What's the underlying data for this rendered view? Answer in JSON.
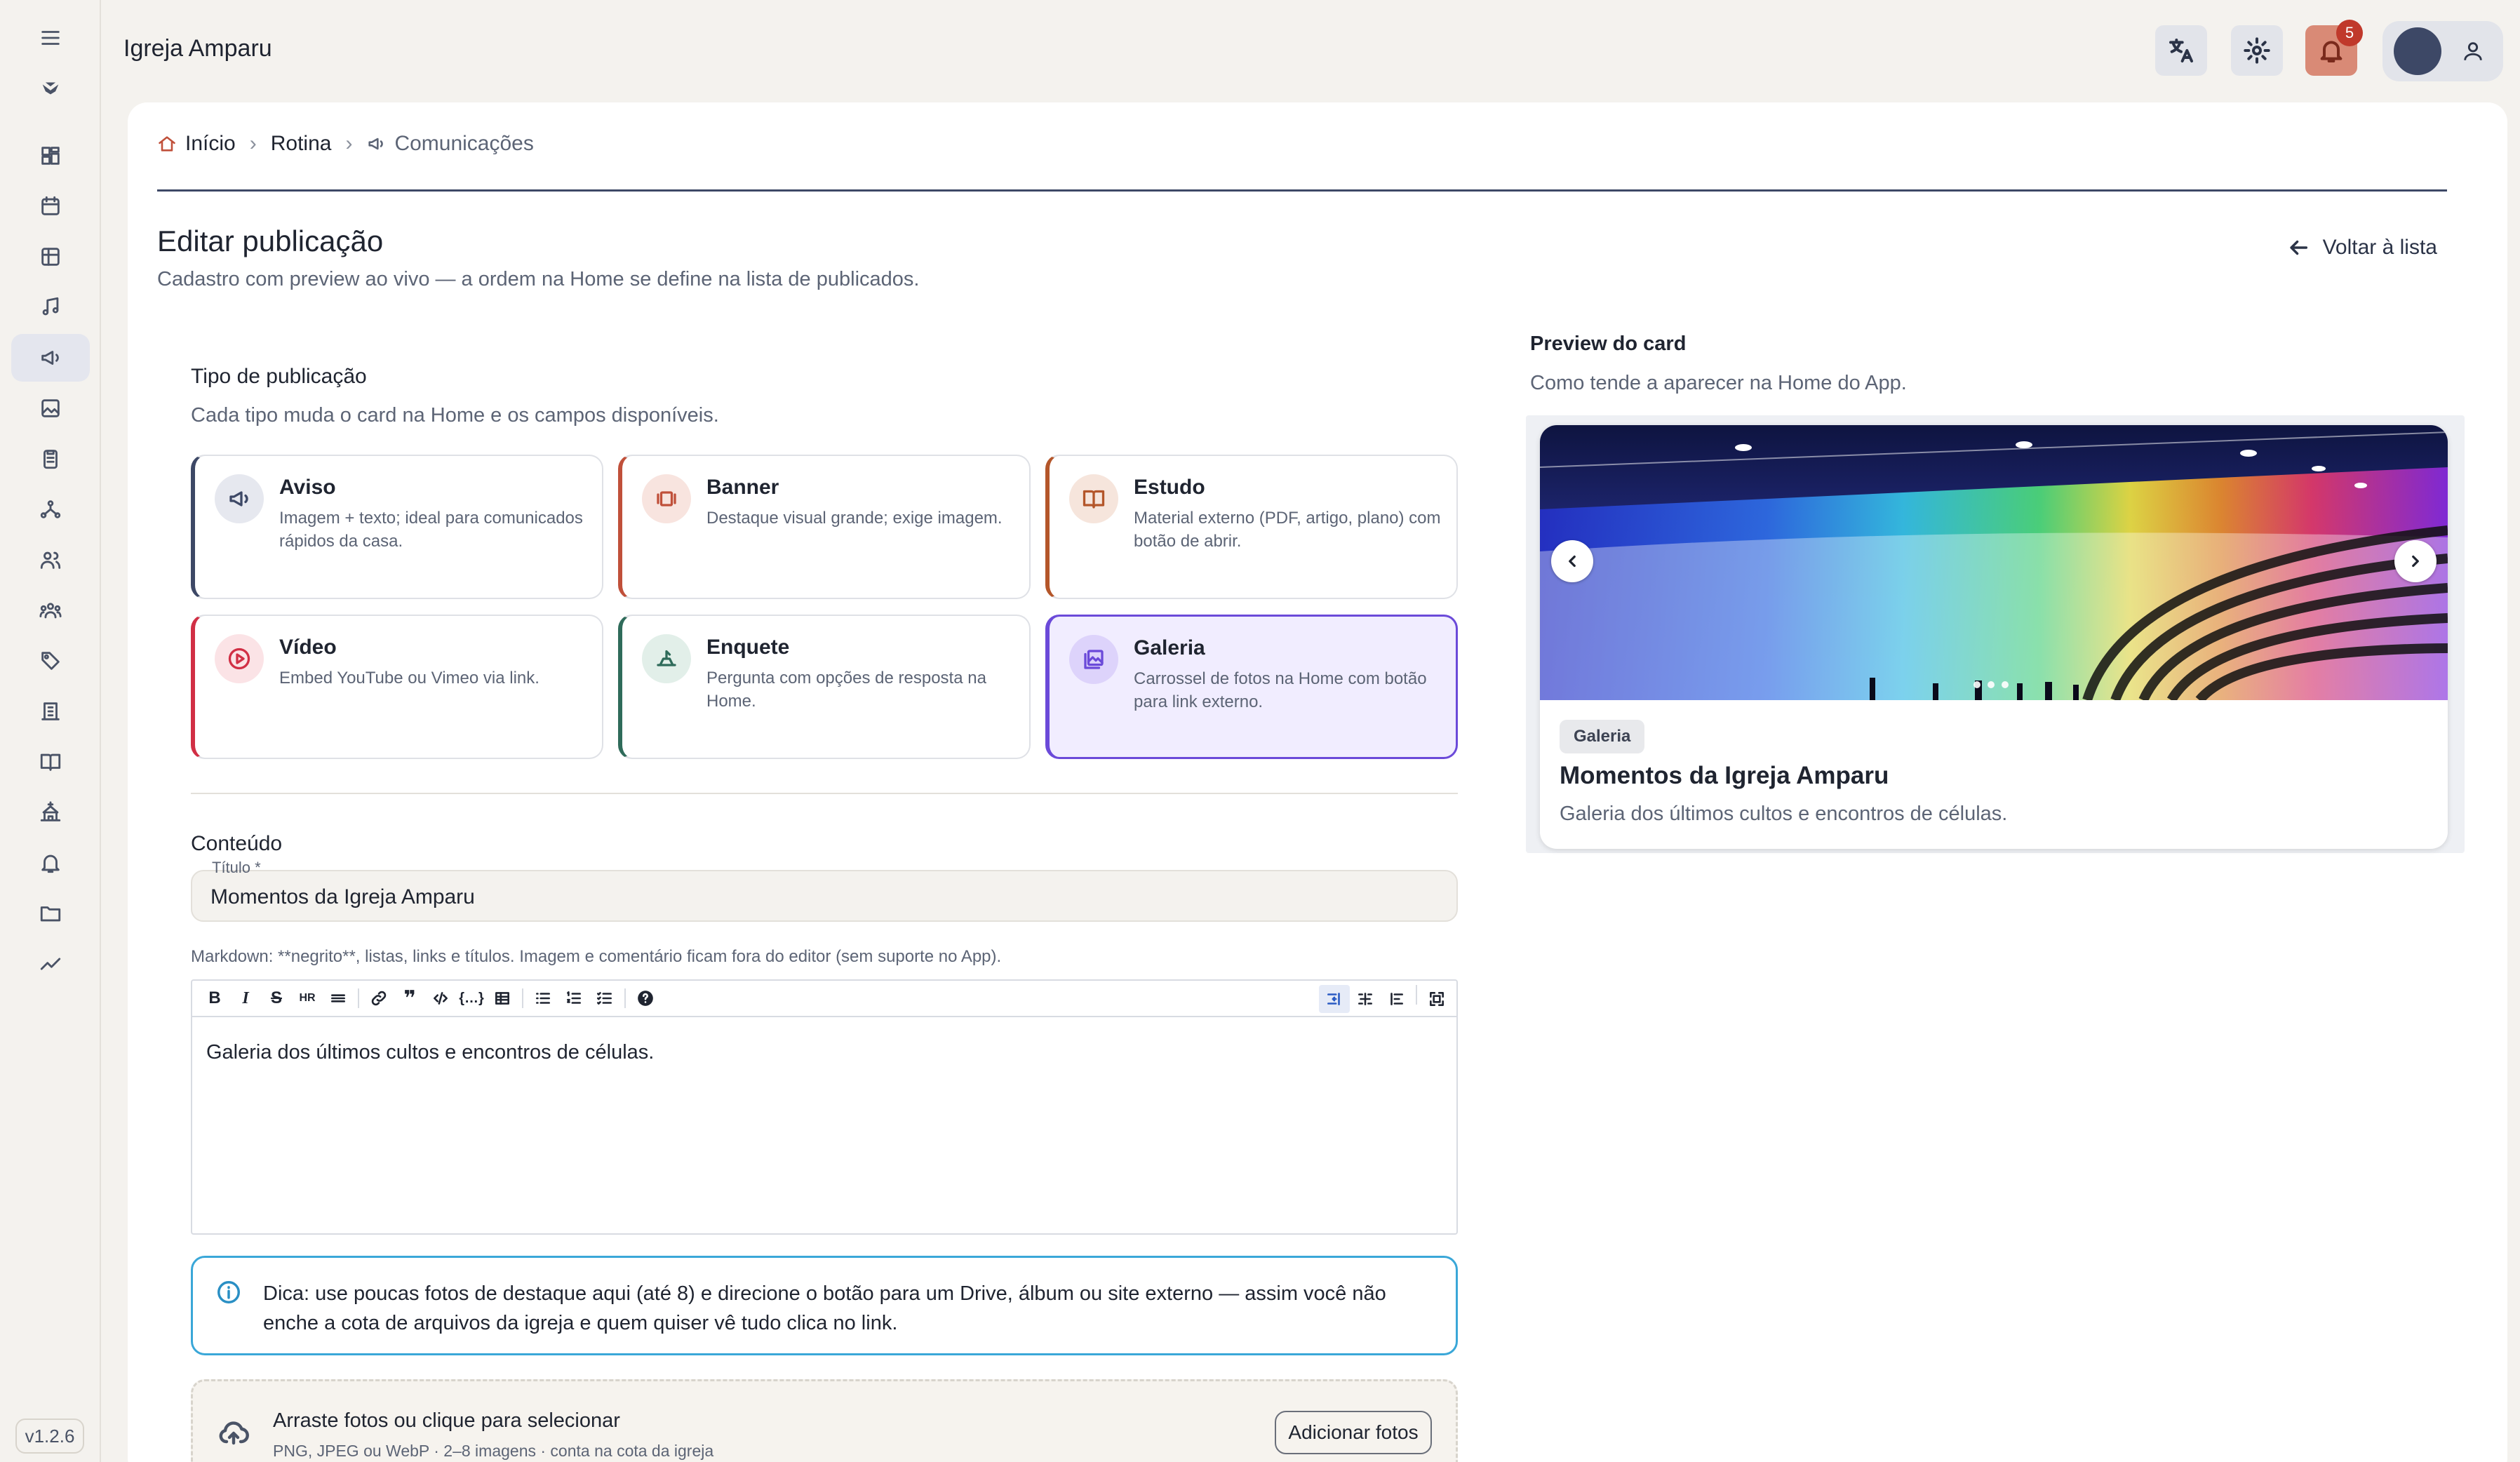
{
  "app": {
    "title": "Igreja Amparu",
    "version": "v1.2.6",
    "notifications_count": "5"
  },
  "sidebar": {
    "icons": [
      "menu-icon",
      "logo-icon",
      "dashboard-icon",
      "calendar-icon",
      "table-icon",
      "music-icon",
      "megaphone-icon",
      "image-icon",
      "clipboard-icon",
      "network-icon",
      "users-icon",
      "group-icon",
      "tag-icon",
      "building-icon",
      "book-icon",
      "church-icon",
      "bell-icon",
      "folder-icon",
      "chart-icon"
    ],
    "active": "megaphone-icon"
  },
  "breadcrumb": {
    "home": "Início",
    "section": "Rotina",
    "current": "Comunicações"
  },
  "page": {
    "title": "Editar publicação",
    "subtitle": "Cadastro com preview ao vivo — a ordem na Home se define na lista de publicados.",
    "back_label": "Voltar à lista"
  },
  "type_section": {
    "title": "Tipo de publicação",
    "subtitle": "Cada tipo muda o card na Home e os campos disponíveis.",
    "types": [
      {
        "name": "Aviso",
        "desc": "Imagem + texto; ideal para comunicados rápidos da casa.",
        "color": "#3d4866"
      },
      {
        "name": "Banner",
        "desc": "Destaque visual grande; exige imagem.",
        "color": "#c0503a"
      },
      {
        "name": "Estudo",
        "desc": "Material externo (PDF, artigo, plano) com botão de abrir.",
        "color": "#b4562a"
      },
      {
        "name": "Vídeo",
        "desc": "Embed YouTube ou Vimeo via link.",
        "color": "#d12f45"
      },
      {
        "name": "Enquete",
        "desc": "Pergunta com opções de resposta na Home.",
        "color": "#2f6b5a"
      },
      {
        "name": "Galeria",
        "desc": "Carrossel de fotos na Home com botão para link externo.",
        "color": "#6b4ad9"
      }
    ],
    "selected": "Galeria"
  },
  "content": {
    "title": "Conteúdo",
    "field_label": "Título *",
    "field_value": "Momentos da Igreja Amparu",
    "markdown_hint": "Markdown: **negrito**, listas, links e títulos. Imagem e comentário ficam fora do editor (sem suporte no App).",
    "editor_text": "Galeria dos últimos cultos e encontros de células."
  },
  "tip": {
    "text": "Dica: use poucas fotos de destaque aqui (até 8) e direcione o botão para um Drive, álbum ou site externo — assim você não enche a cota de arquivos da igreja e quem quiser vê tudo clica no link."
  },
  "upload": {
    "title": "Arraste fotos ou clique para selecionar",
    "subtitle": "PNG, JPEG ou WebP · 2–8 imagens · conta na cota da igreja",
    "button": "Adicionar fotos"
  },
  "preview": {
    "title": "Preview do card",
    "subtitle": "Como tende a aparecer na Home do App.",
    "chip": "Galeria",
    "card_title": "Momentos da Igreja Amparu",
    "card_desc": "Galeria dos últimos cultos e encontros de células."
  }
}
